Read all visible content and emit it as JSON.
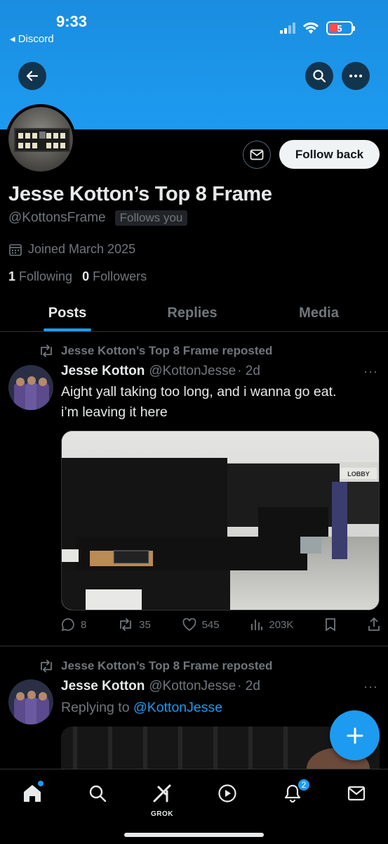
{
  "status_bar": {
    "time": "9:33",
    "back_app": "◂ Discord",
    "battery": "5"
  },
  "profile": {
    "name": "Jesse Kotton’s Top 8 Frame",
    "handle": "@KottonsFrame",
    "follows_you": "Follows you",
    "joined": "Joined March 2025",
    "following_count": "1",
    "following_label": "Following",
    "followers_count": "0",
    "followers_label": "Followers",
    "follow_back_label": "Follow back"
  },
  "tabs": [
    {
      "label": "Posts",
      "active": true
    },
    {
      "label": "Replies",
      "active": false
    },
    {
      "label": "Media",
      "active": false
    }
  ],
  "posts": [
    {
      "repost_text": "Jesse Kotton’s Top 8 Frame reposted",
      "author": "Jesse Kotton",
      "handle": "@KottonJesse",
      "time": "· 2d",
      "text_line1": "Aight yall taking too long, and i wanna go eat.",
      "text_line2": "i’m leaving it here",
      "media_sign": "LOBBY",
      "replies": "8",
      "reposts": "35",
      "likes": "545",
      "views": "203K"
    },
    {
      "repost_text": "Jesse Kotton’s Top 8 Frame reposted",
      "author": "Jesse Kotton",
      "handle": "@KottonJesse",
      "time": "· 2d",
      "replying_prefix": "Replying to",
      "replying_to": "@KottonJesse"
    }
  ],
  "nav": {
    "grok_label": "GROK",
    "notifications_badge": "2"
  },
  "colors": {
    "accent": "#1d9bf0",
    "banner": "#1d9bf0",
    "background": "#000000",
    "muted": "#71767b"
  }
}
